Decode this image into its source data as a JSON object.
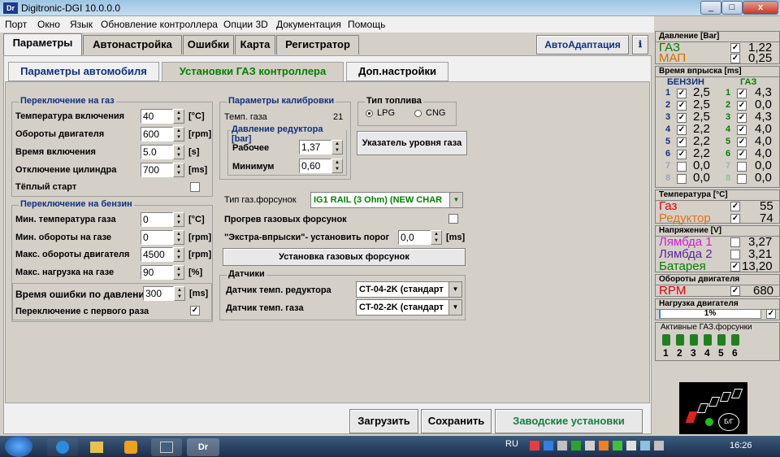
{
  "window": {
    "title": "Digitronic-DGI  10.0.0.0",
    "icon": "Dr",
    "min": "_",
    "max": "□",
    "close": "x"
  },
  "menu": [
    "Порт",
    "Окно",
    "Язык",
    "Обновление контроллера",
    "Опции 3D",
    "Документация",
    "Помощь"
  ],
  "tabs": [
    "Параметры",
    "Автонастройка",
    "Ошибки",
    "Карта",
    "Регистратор"
  ],
  "autoadapt": "АвтоАдаптация",
  "info_icon": "ℹ",
  "subtabs": [
    "Параметры автомобиля",
    "Установки ГАЗ контроллера",
    "Доп.настройки"
  ],
  "gas_switch": {
    "title": "Переключение на газ",
    "rows": [
      {
        "label": "Температура включения",
        "value": "40",
        "unit": "[°C]"
      },
      {
        "label": "Обороты двигателя",
        "value": "600",
        "unit": "[rpm]"
      },
      {
        "label": "Время включения",
        "value": "5.0",
        "unit": "[s]"
      },
      {
        "label": "Отключение цилиндра",
        "value": "700",
        "unit": "[ms]"
      }
    ],
    "warm_start": "Тёплый старт"
  },
  "petrol_switch": {
    "title": "Переключение на бензин",
    "rows": [
      {
        "label": "Мин. температура газа",
        "value": "0",
        "unit": "[°C]"
      },
      {
        "label": "Мин. обороты на газе",
        "value": "0",
        "unit": "[rpm]"
      },
      {
        "label": "Макс. обороты двигателя",
        "value": "4500",
        "unit": "[rpm]"
      },
      {
        "label": "Макс. нагрузка на газе",
        "value": "90",
        "unit": "[%]"
      }
    ],
    "pressure_error_label": "Время ошибки по давлению",
    "pressure_error_value": "300",
    "pressure_error_unit": "[ms]",
    "first_switch": "Переключение с первого раза"
  },
  "calibration": {
    "title": "Параметры калибровки",
    "gas_temp_label": "Темп. газа",
    "gas_temp_value": "21"
  },
  "reducer_pressure": {
    "title": "Давление редуктора [bar]",
    "work_label": "Рабочее",
    "work_value": "1,37",
    "min_label": "Минимум",
    "min_value": "0,60"
  },
  "fuel_type": {
    "title": "Тип топлива",
    "opt1": "LPG",
    "opt2": "CNG",
    "selected": "LPG"
  },
  "level_btn": "Указатель уровня газа",
  "injector_type_label": "Тип газ.форсунок",
  "injector_type_value": "IG1 RAIL (3 Ohm)  (NEW CHAR",
  "injector_heat": "Прогрев газовых форсунок",
  "extra_label": "\"Экстра-впрыски\"- установить порог",
  "extra_value": "0,0",
  "extra_unit": "[ms]",
  "install_btn": "Установка газовых форсунок",
  "sensors": {
    "title": "Датчики",
    "reducer_label": "Датчик темп. редуктора",
    "reducer_value": "CT-04-2K (стандарт",
    "gas_label": "Датчик темп. газа",
    "gas_value": "CT-02-2K (стандарт"
  },
  "bottom_buttons": {
    "load": "Загрузить",
    "save": "Сохранить",
    "factory": "Заводские установки"
  },
  "pressure": {
    "title": "Давление [Bar]",
    "gas_label": "ГАЗ",
    "gas_value": "1,22",
    "map_label": "МАП",
    "map_value": "0,25"
  },
  "injection": {
    "title": "Время впрыска [ms]",
    "petrol_hdr": "БЕНЗИН",
    "gas_hdr": "ГАЗ",
    "rows": [
      {
        "n": "1",
        "p": "2,5",
        "g": "4,3",
        "on": true
      },
      {
        "n": "2",
        "p": "2,5",
        "g": "0,0",
        "on": true
      },
      {
        "n": "3",
        "p": "2,5",
        "g": "4,3",
        "on": true
      },
      {
        "n": "4",
        "p": "2,2",
        "g": "4,0",
        "on": true
      },
      {
        "n": "5",
        "p": "2,2",
        "g": "4,0",
        "on": true
      },
      {
        "n": "6",
        "p": "2,2",
        "g": "4,0",
        "on": true
      },
      {
        "n": "7",
        "p": "0,0",
        "g": "0,0",
        "on": false
      },
      {
        "n": "8",
        "p": "0,0",
        "g": "0,0",
        "on": false
      }
    ]
  },
  "temperature": {
    "title": "Температура [°C]",
    "gas_label": "Газ",
    "gas_value": "55",
    "red_label": "Редуктор",
    "red_value": "74"
  },
  "voltage": {
    "title": "Напряжение [V]",
    "l1_label": "Лямбда 1",
    "l1_value": "3,27",
    "l2_label": "Лямбда 2",
    "l2_value": "3,21",
    "bat_label": "Батарея",
    "bat_value": "13,20"
  },
  "rpm": {
    "title": "Обороты двигателя",
    "label": "RPM",
    "value": "680"
  },
  "load": {
    "title": "Нагрузка двигателя",
    "value": "1%",
    "fraction": 0.01
  },
  "active_injectors": {
    "title": "Активные ГАЗ.форсунки",
    "nums": [
      "1",
      "2",
      "3",
      "4",
      "5",
      "6"
    ]
  },
  "switch_label": "Б/Г",
  "tray": {
    "lang": "RU",
    "time": "16:26"
  },
  "taskbar_app": "Dr",
  "colors": {
    "accent_blue": "#103080",
    "gas_green": "#008000",
    "orange": "#e07020",
    "magenta": "#d020d0",
    "purple": "#6020a0",
    "red": "#e00000"
  }
}
